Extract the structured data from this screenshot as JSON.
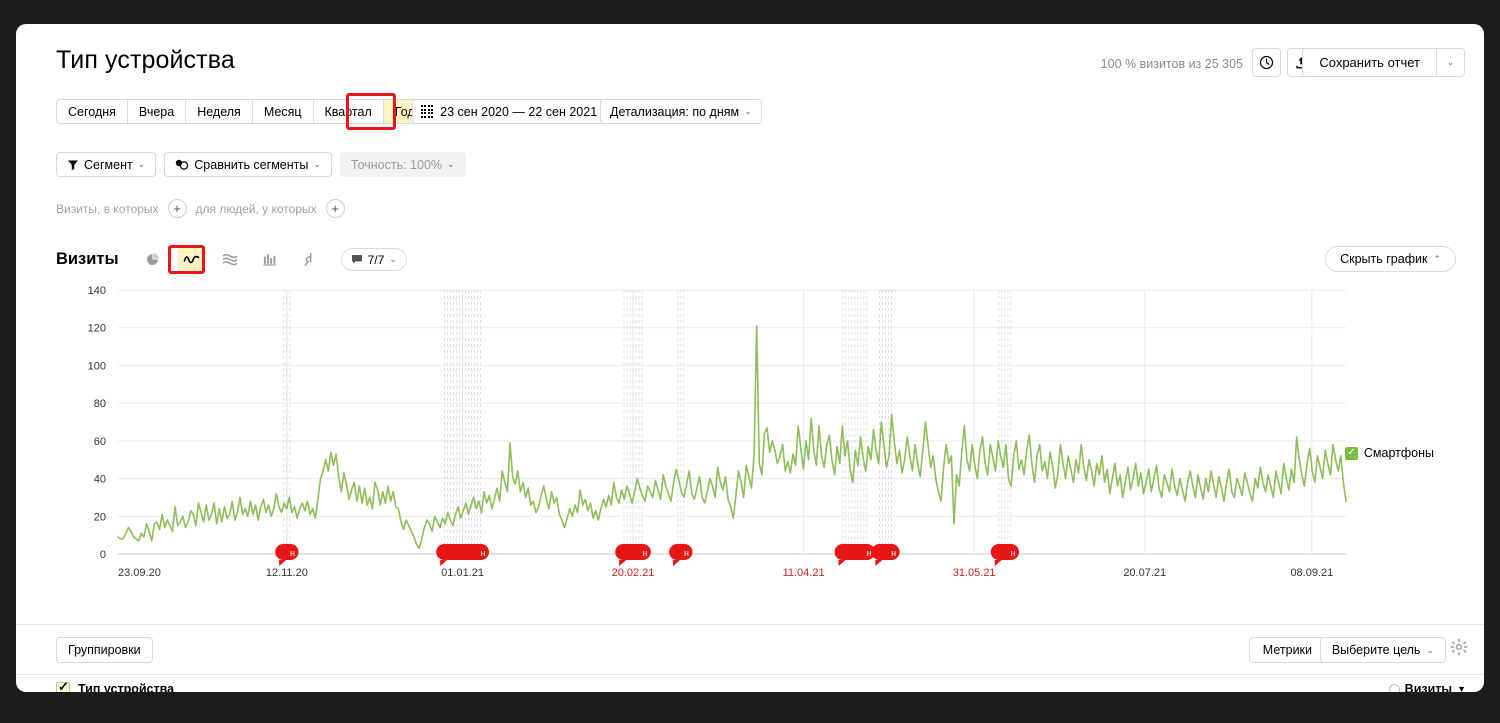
{
  "header": {
    "title": "Тип устройства",
    "visits_note": "100 % визитов из 25 305",
    "clock_icon": "clock-icon",
    "export_icon": "export-icon",
    "save_report_label": "Сохранить отчет",
    "save_caret": "⌄"
  },
  "period_tabs": [
    {
      "label": "Сегодня",
      "selected": false
    },
    {
      "label": "Вчера",
      "selected": false
    },
    {
      "label": "Неделя",
      "selected": false
    },
    {
      "label": "Месяц",
      "selected": false
    },
    {
      "label": "Квартал",
      "selected": false
    },
    {
      "label": "Год",
      "selected": true
    }
  ],
  "date_range": {
    "icon": "calendar-grid-icon",
    "value": "23 сен 2020 — 22 сен 2021"
  },
  "detail": {
    "label": "Детализация: по дням",
    "caret": "⌄"
  },
  "segments": {
    "segment_label": "Сегмент",
    "segment_icon": "funnel-icon",
    "compare_label": "Сравнить сегменты",
    "compare_icon": "compare-icon",
    "accuracy_label": "Точность: 100%",
    "caret": "⌄"
  },
  "filters": {
    "visits_text": "Визиты, в которых",
    "people_text": "для людей, у которых",
    "plus": "+"
  },
  "chart_toolbar": {
    "metric_title": "Визиты",
    "viz_buttons": [
      {
        "name": "pie-chart-icon",
        "selected": false
      },
      {
        "name": "line-chart-icon",
        "selected": true
      },
      {
        "name": "area-chart-icon",
        "selected": false
      },
      {
        "name": "bar-chart-icon",
        "selected": false
      },
      {
        "name": "map-pin-icon",
        "selected": false
      }
    ],
    "comment_icon": "comment-bubble-icon",
    "comment_count": "7/7",
    "comment_caret": "⌄",
    "hide_chart_label": "Скрыть график",
    "hide_chart_caret": "⌃"
  },
  "legend": [
    {
      "label": "Смартфоны",
      "color": "#7cbb42",
      "checked": true
    }
  ],
  "footer": {
    "groupings_label": "Группировки",
    "metrics_label": "Метрики",
    "goal_label": "Выберите цель",
    "goal_caret": "⌄",
    "gear_icon": "gear-icon",
    "column_header_left": "Тип устройства",
    "column_header_right": "Визиты",
    "sort_caret": "▼",
    "info_icon": "info-circle-icon"
  },
  "highlights": [
    {
      "name": "year-tab-highlight",
      "color": "#e81616"
    },
    {
      "name": "line-chart-button-highlight",
      "color": "#e81616"
    }
  ],
  "chart_data": {
    "type": "line",
    "title": "Визиты",
    "xlabel": "",
    "ylabel": "",
    "ylim": [
      0,
      140
    ],
    "yticks": [
      0,
      20,
      40,
      60,
      80,
      100,
      120,
      140
    ],
    "grid": true,
    "legend_position": "right",
    "xtick_labels": [
      {
        "label": "23.09.20",
        "pos": 0.0,
        "holiday": false
      },
      {
        "label": "12.11.20",
        "pos": 0.1375,
        "holiday": false
      },
      {
        "label": "01.01.21",
        "pos": 0.2806,
        "holiday": false
      },
      {
        "label": "20.02.21",
        "pos": 0.4194,
        "holiday": true
      },
      {
        "label": "11.04.21",
        "pos": 0.5583,
        "holiday": true
      },
      {
        "label": "31.05.21",
        "pos": 0.6972,
        "holiday": true
      },
      {
        "label": "20.07.21",
        "pos": 0.8361,
        "holiday": false
      },
      {
        "label": "08.09.21",
        "pos": 0.9722,
        "holiday": false
      }
    ],
    "holiday_markers": [
      {
        "pos": 0.1375,
        "label": "н",
        "width": 0.006
      },
      {
        "pos": 0.2806,
        "label": "н",
        "width": 0.03
      },
      {
        "pos": 0.4194,
        "label": "н",
        "width": 0.016
      },
      {
        "pos": 0.4583,
        "label": "н",
        "width": 0.006
      },
      {
        "pos": 0.6,
        "label": "н",
        "width": 0.02
      },
      {
        "pos": 0.625,
        "label": "н",
        "width": 0.01
      },
      {
        "pos": 0.7222,
        "label": "н",
        "width": 0.01
      }
    ],
    "series": [
      {
        "name": "Смартфоны",
        "color": "#8dbe5a",
        "values": [
          9,
          8,
          8,
          11,
          14,
          12,
          9,
          8,
          7,
          11,
          9,
          16,
          12,
          7,
          16,
          17,
          13,
          21,
          14,
          18,
          15,
          12,
          25,
          15,
          17,
          20,
          14,
          17,
          23,
          21,
          15,
          27,
          22,
          17,
          26,
          18,
          21,
          27,
          16,
          24,
          17,
          25,
          19,
          21,
          28,
          18,
          22,
          30,
          21,
          24,
          20,
          28,
          21,
          26,
          18,
          25,
          29,
          22,
          26,
          20,
          24,
          32,
          25,
          22,
          27,
          24,
          30,
          22,
          25,
          19,
          24,
          27,
          23,
          28,
          21,
          24,
          19,
          29,
          40,
          44,
          50,
          44,
          54,
          47,
          53,
          41,
          33,
          43,
          37,
          29,
          34,
          38,
          28,
          36,
          27,
          35,
          26,
          30,
          24,
          38,
          34,
          26,
          33,
          27,
          36,
          28,
          33,
          25,
          24,
          17,
          13,
          18,
          15,
          12,
          9,
          5,
          3,
          8,
          14,
          18,
          16,
          12,
          20,
          17,
          14,
          19,
          16,
          22,
          18,
          15,
          21,
          25,
          19,
          23,
          27,
          21,
          26,
          30,
          24,
          28,
          22,
          33,
          27,
          31,
          24,
          29,
          35,
          28,
          44,
          38,
          33,
          59,
          41,
          37,
          44,
          33,
          38,
          30,
          35,
          26,
          28,
          22,
          25,
          31,
          36,
          29,
          24,
          33,
          27,
          30,
          21,
          18,
          14,
          19,
          24,
          20,
          26,
          22,
          34,
          26,
          29,
          23,
          27,
          19,
          23,
          18,
          24,
          29,
          25,
          31,
          26,
          38,
          30,
          27,
          34,
          29,
          36,
          32,
          27,
          33,
          40,
          35,
          31,
          28,
          36,
          33,
          30,
          39,
          34,
          29,
          42,
          36,
          32,
          28,
          38,
          45,
          39,
          33,
          30,
          37,
          44,
          32,
          29,
          35,
          41,
          30,
          27,
          33,
          40,
          36,
          30,
          46,
          38,
          34,
          41,
          29,
          25,
          19,
          31,
          44,
          38,
          30,
          47,
          41,
          35,
          53,
          121,
          48,
          42,
          64,
          67,
          54,
          60,
          55,
          48,
          52,
          58,
          44,
          49,
          43,
          53,
          47,
          68,
          56,
          45,
          60,
          50,
          72,
          55,
          47,
          68,
          52,
          46,
          58,
          63,
          50,
          42,
          57,
          48,
          68,
          52,
          60,
          45,
          38,
          55,
          47,
          62,
          51,
          44,
          57,
          50,
          66,
          55,
          48,
          70,
          58,
          46,
          52,
          74,
          60,
          48,
          55,
          43,
          50,
          62,
          52,
          44,
          58,
          48,
          41,
          55,
          70,
          58,
          46,
          52,
          40,
          33,
          28,
          46,
          58,
          48,
          52,
          16,
          42,
          36,
          54,
          68,
          50,
          44,
          58,
          47,
          40,
          55,
          62,
          48,
          42,
          58,
          51,
          44,
          60,
          52,
          46,
          58,
          40,
          36,
          52,
          60,
          45,
          50,
          42,
          55,
          63,
          48,
          38,
          52,
          58,
          44,
          49,
          40,
          54,
          47,
          35,
          42,
          58,
          48,
          40,
          52,
          45,
          38,
          50,
          43,
          58,
          46,
          39,
          50,
          44,
          36,
          48,
          42,
          52,
          38,
          45,
          32,
          40,
          48,
          36,
          42,
          30,
          38,
          46,
          34,
          40,
          48,
          36,
          43,
          32,
          38,
          45,
          33,
          40,
          47,
          35,
          30,
          42,
          38,
          33,
          45,
          36,
          31,
          40,
          34,
          28,
          38,
          44,
          36,
          30,
          42,
          35,
          29,
          40,
          33,
          44,
          37,
          30,
          41,
          35,
          28,
          38,
          45,
          33,
          30,
          40,
          36,
          31,
          43,
          38,
          32,
          28,
          40,
          35,
          46,
          38,
          33,
          42,
          36,
          30,
          44,
          38,
          32,
          48,
          40,
          34,
          45,
          38,
          62,
          50,
          42,
          36,
          48,
          56,
          44,
          38,
          52,
          46,
          40,
          55,
          48,
          42,
          58,
          50,
          44,
          52,
          38,
          28
        ]
      }
    ]
  }
}
